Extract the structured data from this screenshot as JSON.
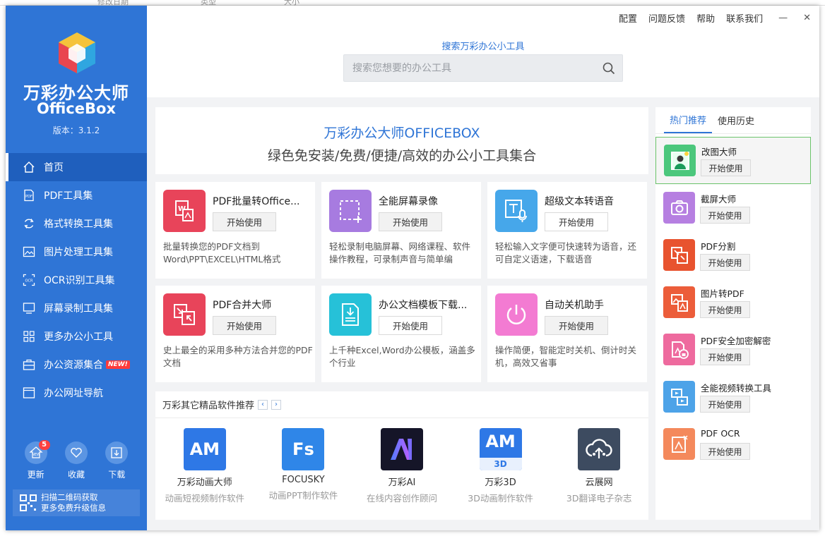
{
  "background_window": {
    "columns": [
      "修改日期",
      "类型",
      "大小"
    ]
  },
  "sidebar": {
    "title": "万彩办公大师",
    "subtitle": "OfficeBox",
    "version": "版本：3.1.2",
    "nav": [
      {
        "label": "首页",
        "icon": "home-icon",
        "active": true
      },
      {
        "label": "PDF工具集",
        "icon": "pdf-icon"
      },
      {
        "label": "格式转换工具集",
        "icon": "convert-icon"
      },
      {
        "label": "图片处理工具集",
        "icon": "image-icon"
      },
      {
        "label": "OCR识别工具集",
        "icon": "ocr-icon"
      },
      {
        "label": "屏幕录制工具集",
        "icon": "screen-icon"
      },
      {
        "label": "更多办公小工具",
        "icon": "grid-icon"
      },
      {
        "label": "办公资源集合",
        "icon": "briefcase-icon",
        "badge": "NEW!"
      },
      {
        "label": "办公网址导航",
        "icon": "browser-icon"
      }
    ],
    "bottom": [
      {
        "label": "更新",
        "badge": "5",
        "inner": "NEW"
      },
      {
        "label": "收藏"
      },
      {
        "label": "下载"
      }
    ],
    "qr_line1": "扫描二维码获取",
    "qr_line2": "更多免费升级信息"
  },
  "topbar": {
    "links": [
      "配置",
      "问题反馈",
      "帮助",
      "联系我们"
    ],
    "minimize": "—",
    "close": "✕",
    "search_label": "搜索万彩办公小工具",
    "search_placeholder": "搜索您想要的办公工具"
  },
  "banner": {
    "line1": "万彩办公大师OFFICEBOX",
    "line2": "绿色免安装/免费/便捷/高效的办公小工具集合"
  },
  "start_label": "开始使用",
  "tools": [
    {
      "title": "PDF批量转Office...",
      "desc": "批量转换您的PDF文档到Word\\PPT\\EXCEL\\HTML格式",
      "color": "#e8445a"
    },
    {
      "title": "全能屏幕录像",
      "desc": "轻松录制电脑屏幕、网络课程、软件操作教程，可录制声音与简单编",
      "color": "#a77be0"
    },
    {
      "title": "超级文本转语音",
      "desc": "轻松输入文字便可快速转为语音，还可自定义语速，下载语音",
      "color": "#46a7ea"
    },
    {
      "title": "PDF合并大师",
      "desc": "史上最全的采用多种方法合并您的PDF文档",
      "color": "#e8445a"
    },
    {
      "title": "办公文档模板下载...",
      "desc": "上千种Excel,Word办公模板，涵盖多个行业",
      "color": "#26c1d8"
    },
    {
      "title": "自动关机助手",
      "desc": "操作简便，智能定时关机、倒计时关机，高效又省事",
      "color": "#f37bd2"
    }
  ],
  "recommend": {
    "title": "万彩其它精品软件推荐",
    "prev": "‹",
    "next": "›",
    "items": [
      {
        "icon_text": "AM",
        "name": "万彩动画大师",
        "desc": "动画短视频制作软件",
        "color": "#2e78e6"
      },
      {
        "icon_text": "Fs",
        "name": "FOCUSKY",
        "desc": "动画PPT制作软件",
        "color": "#2f86e8"
      },
      {
        "icon_text": "AI",
        "name": "万彩AI",
        "desc": "在线内容创作顾问",
        "color": "#1a1a2e"
      },
      {
        "icon_text": "AM",
        "icon_sub": "3D",
        "name": "万彩3D",
        "desc": "3D动画制作软件",
        "color": "#2e78e6"
      },
      {
        "icon_text": "",
        "name": "云展网",
        "desc": "3D翻译电子杂志",
        "color": "#3d4b60"
      }
    ]
  },
  "right_panel": {
    "tabs": [
      "热门推荐",
      "使用历史"
    ],
    "items": [
      {
        "name": "改图大师",
        "color": "#4cc77c",
        "selected": true
      },
      {
        "name": "截屏大师",
        "color": "#b67fe1"
      },
      {
        "name": "PDF分割",
        "color": "#e8532f"
      },
      {
        "name": "图片转PDF",
        "color": "#ec5d3a"
      },
      {
        "name": "PDF安全加密解密",
        "color": "#ee6a9e"
      },
      {
        "name": "全能视频转换工具",
        "color": "#4da3e8"
      },
      {
        "name": "PDF OCR",
        "color": "#f4895c"
      }
    ]
  }
}
